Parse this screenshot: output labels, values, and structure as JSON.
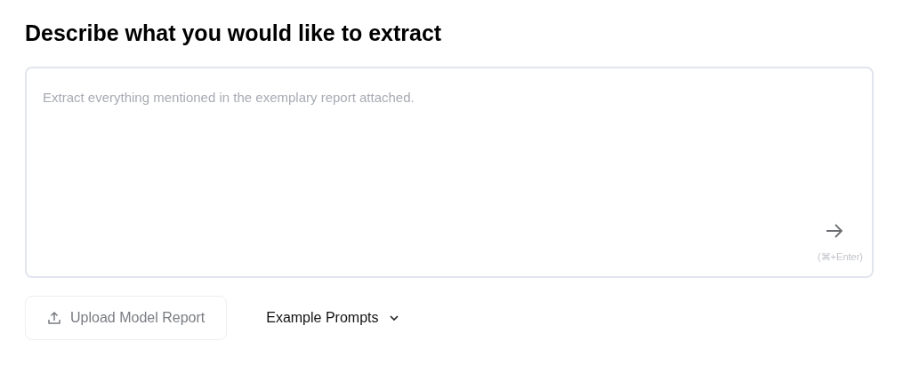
{
  "heading": "Describe what you would like to extract",
  "prompt": {
    "placeholder": "Extract everything mentioned in the exemplary report attached.",
    "shortcut": "(⌘+Enter)"
  },
  "buttons": [
    {
      "kind": "upload",
      "label": "Upload Model Report",
      "disabled": true
    },
    {
      "kind": "dropdown",
      "label": "Example Prompts",
      "disabled": false
    }
  ]
}
